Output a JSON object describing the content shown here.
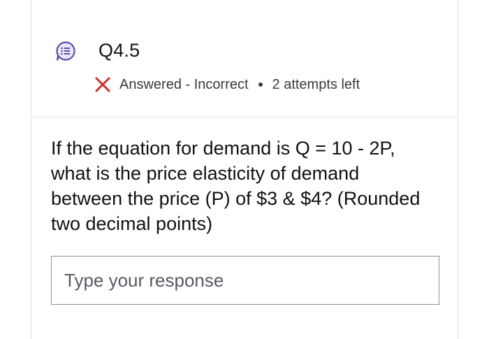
{
  "question": {
    "number": "Q4.5",
    "icon": "question-list-icon",
    "status": {
      "icon": "x-mark-icon",
      "result_text": "Answered - Incorrect",
      "attempts_text": "2 attempts left",
      "status_color": "#d93025"
    },
    "prompt": "If the equation for demand is Q = 10 - 2P, what is the price elasticity of demand between the price (P) of $3 & $4? (Rounded two decimal points)",
    "response": {
      "placeholder": "Type your response",
      "value": ""
    }
  },
  "colors": {
    "accent": "#5b4bb7",
    "accent_bg": "#ece9f7",
    "border": "#e3e3e3",
    "input_border": "#8a8f99"
  }
}
